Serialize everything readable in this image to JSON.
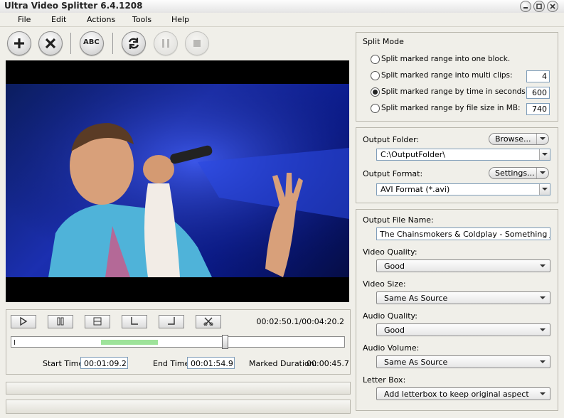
{
  "window": {
    "title": "Ultra Video Splitter 6.4.1208"
  },
  "menu": [
    "File",
    "Edit",
    "Actions",
    "Tools",
    "Help"
  ],
  "toolbar": {
    "add_label": "+",
    "abc_label": "ABC"
  },
  "player": {
    "timecode": "00:02:50.1/00:04:20.2",
    "marked_position": 0.44,
    "mark_start": 0.27,
    "mark_end": 0.44,
    "start_time_label": "Start Time:",
    "start_time": "00:01:09.2",
    "end_time_label": "End Time:",
    "end_time": "00:01:54.9",
    "marked_duration_label": "Marked Duration:",
    "marked_duration": "00:00:45.7"
  },
  "split_mode": {
    "title": "Split Mode",
    "options": [
      {
        "label": "Split  marked range into one block.",
        "value": "",
        "selected": false
      },
      {
        "label": "Split marked range into multi clips:",
        "value": "4",
        "selected": false
      },
      {
        "label": "Split marked range by time in seconds:",
        "value": "600",
        "selected": true
      },
      {
        "label": "Split marked range by file size in MB:",
        "value": "740",
        "selected": false
      }
    ]
  },
  "output": {
    "folder_label": "Output Folder:",
    "browse_label": "Browse...",
    "folder_value": "C:\\OutputFolder\\",
    "format_label": "Output Format:",
    "settings_label": "Settings...",
    "format_value": "AVI Format (*.avi)"
  },
  "options": {
    "file_name_label": "Output File Name:",
    "file_name_value": "The Chainsmokers & Coldplay - Something Just Like This",
    "video_quality_label": "Video Quality:",
    "video_quality_value": "Good",
    "video_size_label": "Video Size:",
    "video_size_value": "Same As Source",
    "audio_quality_label": "Audio Quality:",
    "audio_quality_value": "Good",
    "audio_volume_label": "Audio Volume:",
    "audio_volume_value": "Same As Source",
    "letter_box_label": "Letter Box:",
    "letter_box_value": "Add letterbox to keep original aspect"
  },
  "colors": {
    "accent_fill": "#9ee39a",
    "video_bg": "#1b2fb0"
  }
}
